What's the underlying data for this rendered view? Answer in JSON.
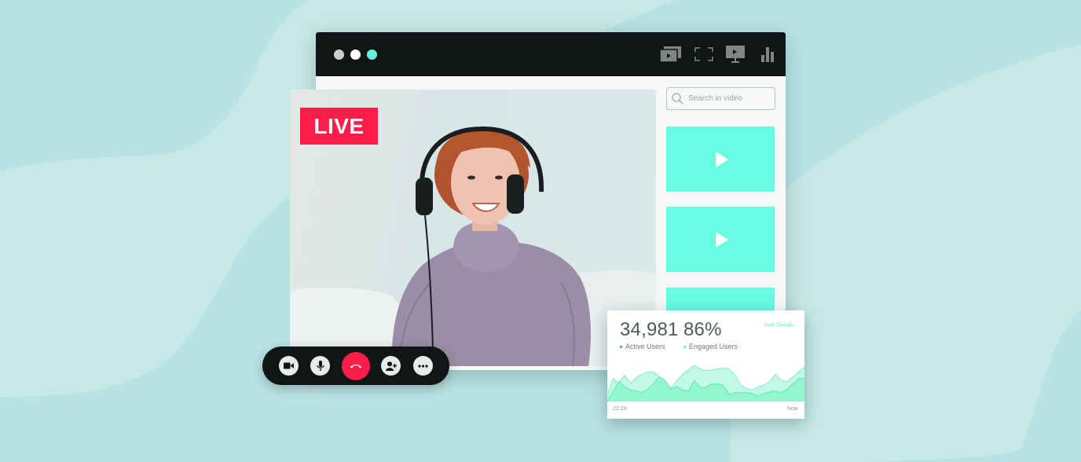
{
  "window": {
    "traffic_lights": [
      {
        "name": "grey",
        "color": "#c8cfcf"
      },
      {
        "name": "white",
        "color": "#ffffff"
      },
      {
        "name": "teal",
        "color": "#64f2dc"
      }
    ],
    "toolbar_icons": [
      "picture-in-picture-icon",
      "fullscreen-icon",
      "cast-screen-icon",
      "analytics-icon"
    ]
  },
  "video": {
    "live_badge": "LIVE",
    "live_color": "#fd1d4b"
  },
  "sidebar": {
    "search": {
      "placeholder": "Search in video",
      "value": ""
    },
    "thumbnails": [
      {
        "icon": "play-icon"
      },
      {
        "icon": "play-icon"
      },
      {
        "icon": "play-icon"
      }
    ],
    "thumb_color": "#68fce3"
  },
  "call_controls": [
    {
      "name": "camera",
      "icon": "video-camera-icon"
    },
    {
      "name": "microphone",
      "icon": "microphone-icon"
    },
    {
      "name": "end-call",
      "icon": "phone-hangup-icon",
      "color": "#fd1d4b"
    },
    {
      "name": "add-participant",
      "icon": "add-user-icon"
    },
    {
      "name": "more",
      "icon": "more-horizontal-icon"
    }
  ],
  "analytics": {
    "active_users": {
      "value": "34,981",
      "label": "Active Users",
      "color": "#1fae83"
    },
    "engaged_users": {
      "value": "86%",
      "label": "Engaged Users",
      "color": "#4ff0c0"
    },
    "see_details": "See Details",
    "x_start": "22:23",
    "x_end": "Now"
  },
  "chart_data": {
    "type": "area",
    "title": "",
    "xlabel": "",
    "ylabel": "",
    "x_labels": [
      "22:23",
      "Now"
    ],
    "ylim": [
      0,
      100
    ],
    "grid": false,
    "series": [
      {
        "name": "Engaged Users",
        "color": "#c2f8e6",
        "values": [
          14,
          52,
          42,
          60,
          42,
          55,
          62,
          67,
          67,
          55,
          38,
          30,
          48,
          62,
          72,
          82,
          75,
          70,
          72,
          74,
          76,
          74,
          60,
          38,
          30,
          26,
          33,
          38,
          45,
          62,
          48,
          45,
          56,
          68,
          78
        ]
      },
      {
        "name": "Active Users",
        "color": "#8ef5cd",
        "values": [
          2,
          22,
          46,
          34,
          26,
          24,
          20,
          28,
          42,
          56,
          48,
          28,
          34,
          26,
          24,
          48,
          32,
          32,
          40,
          40,
          36,
          16,
          20,
          20,
          20,
          18,
          12,
          18,
          22,
          24,
          20,
          28,
          40,
          52,
          52
        ]
      }
    ]
  }
}
